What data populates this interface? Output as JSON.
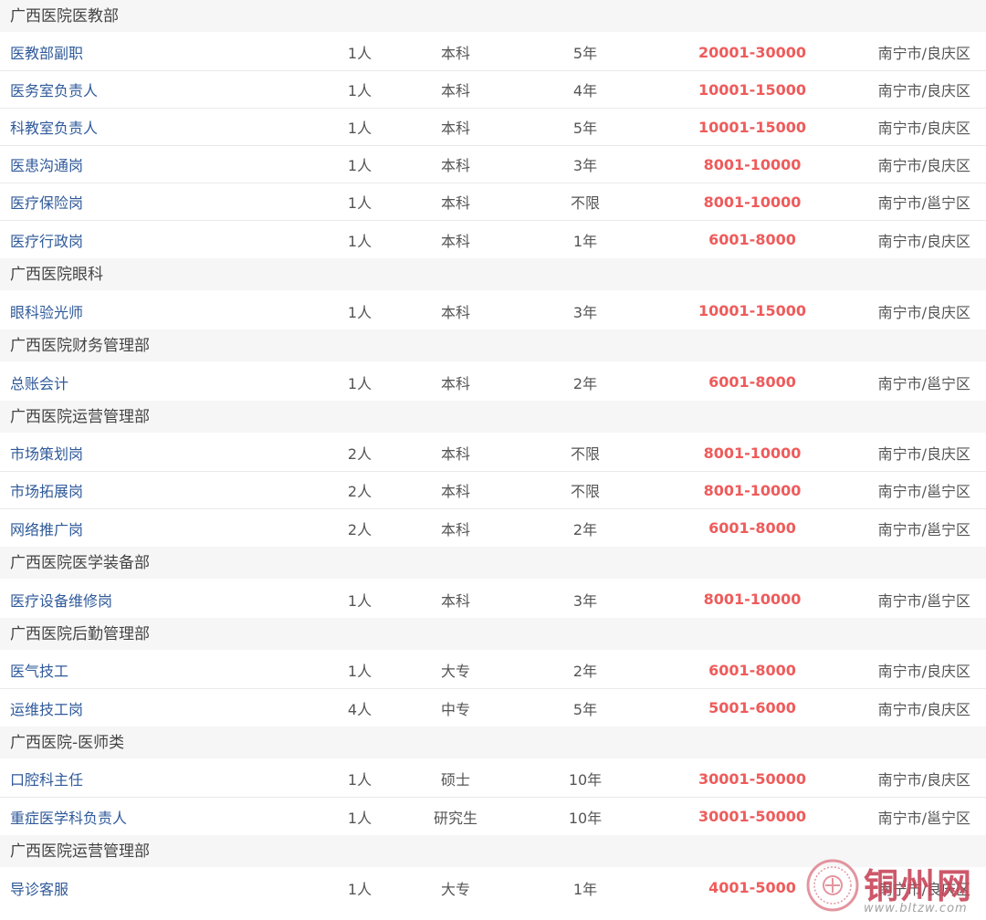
{
  "sections": [
    {
      "name": "广西医院医教部",
      "jobs": [
        {
          "title": "医教部副职",
          "count": "1人",
          "edu": "本科",
          "exp": "5年",
          "salary": "20001-30000",
          "location": "南宁市/良庆区"
        },
        {
          "title": "医务室负责人",
          "count": "1人",
          "edu": "本科",
          "exp": "4年",
          "salary": "10001-15000",
          "location": "南宁市/良庆区"
        },
        {
          "title": "科教室负责人",
          "count": "1人",
          "edu": "本科",
          "exp": "5年",
          "salary": "10001-15000",
          "location": "南宁市/良庆区"
        },
        {
          "title": "医患沟通岗",
          "count": "1人",
          "edu": "本科",
          "exp": "3年",
          "salary": "8001-10000",
          "location": "南宁市/良庆区"
        },
        {
          "title": "医疗保险岗",
          "count": "1人",
          "edu": "本科",
          "exp": "不限",
          "salary": "8001-10000",
          "location": "南宁市/邕宁区"
        },
        {
          "title": "医疗行政岗",
          "count": "1人",
          "edu": "本科",
          "exp": "1年",
          "salary": "6001-8000",
          "location": "南宁市/良庆区"
        }
      ]
    },
    {
      "name": "广西医院眼科",
      "jobs": [
        {
          "title": "眼科验光师",
          "count": "1人",
          "edu": "本科",
          "exp": "3年",
          "salary": "10001-15000",
          "location": "南宁市/良庆区"
        }
      ]
    },
    {
      "name": "广西医院财务管理部",
      "jobs": [
        {
          "title": "总账会计",
          "count": "1人",
          "edu": "本科",
          "exp": "2年",
          "salary": "6001-8000",
          "location": "南宁市/邕宁区"
        }
      ]
    },
    {
      "name": "广西医院运营管理部",
      "jobs": [
        {
          "title": "市场策划岗",
          "count": "2人",
          "edu": "本科",
          "exp": "不限",
          "salary": "8001-10000",
          "location": "南宁市/良庆区"
        },
        {
          "title": "市场拓展岗",
          "count": "2人",
          "edu": "本科",
          "exp": "不限",
          "salary": "8001-10000",
          "location": "南宁市/邕宁区"
        },
        {
          "title": "网络推广岗",
          "count": "2人",
          "edu": "本科",
          "exp": "2年",
          "salary": "6001-8000",
          "location": "南宁市/邕宁区"
        }
      ]
    },
    {
      "name": "广西医院医学装备部",
      "jobs": [
        {
          "title": "医疗设备维修岗",
          "count": "1人",
          "edu": "本科",
          "exp": "3年",
          "salary": "8001-10000",
          "location": "南宁市/邕宁区"
        }
      ]
    },
    {
      "name": "广西医院后勤管理部",
      "jobs": [
        {
          "title": "医气技工",
          "count": "1人",
          "edu": "大专",
          "exp": "2年",
          "salary": "6001-8000",
          "location": "南宁市/良庆区"
        },
        {
          "title": "运维技工岗",
          "count": "4人",
          "edu": "中专",
          "exp": "5年",
          "salary": "5001-6000",
          "location": "南宁市/良庆区"
        }
      ]
    },
    {
      "name": "广西医院-医师类",
      "jobs": [
        {
          "title": "口腔科主任",
          "count": "1人",
          "edu": "硕士",
          "exp": "10年",
          "salary": "30001-50000",
          "location": "南宁市/良庆区"
        },
        {
          "title": "重症医学科负责人",
          "count": "1人",
          "edu": "研究生",
          "exp": "10年",
          "salary": "30001-50000",
          "location": "南宁市/邕宁区"
        }
      ]
    },
    {
      "name": "广西医院运营管理部",
      "jobs": [
        {
          "title": "导诊客服",
          "count": "1人",
          "edu": "大专",
          "exp": "1年",
          "salary": "4001-5000",
          "location": "南宁市/良庆区"
        }
      ]
    }
  ],
  "watermark": {
    "name": "铜州网",
    "url": "www.bltzw.com"
  },
  "colors": {
    "title_link": "#2f5a9a",
    "salary": "#ef5b5b",
    "section_bg": "#f6f6f6"
  }
}
